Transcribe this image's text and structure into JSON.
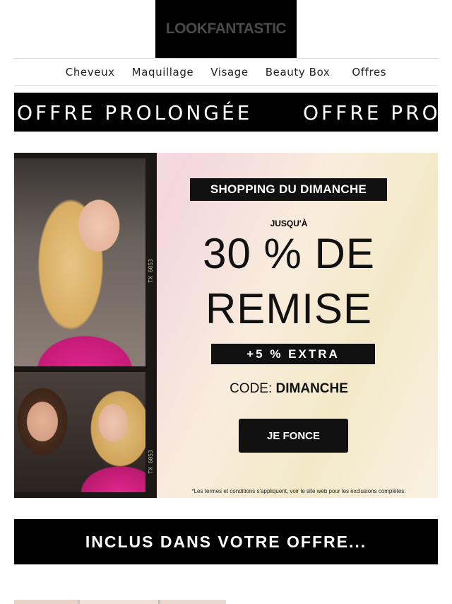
{
  "header": {
    "logo_text": "LOOKFANTASTIC"
  },
  "nav": {
    "items": [
      {
        "label": "Cheveux"
      },
      {
        "label": "Maquillage"
      },
      {
        "label": "Visage"
      },
      {
        "label": "Beauty Box"
      },
      {
        "label": "Offres"
      }
    ]
  },
  "ticker": {
    "text": "OFFRE PROLONGÉE",
    "repeat_text": "OFFRE PRO"
  },
  "hero": {
    "tag": "SHOPPING DU DIMANCHE",
    "upto": "JUSQU'À",
    "headline_line1": "30 % DE",
    "headline_line2": "REMISE",
    "extra": "+5 % EXTRA",
    "code_label": "CODE:",
    "code_value": "DIMANCHE",
    "cta_label": "JE FONCE",
    "terms": "*Les termes et conditions s'appliquent, voir le site web pour les exclusions complètes.",
    "film_mark_top": "TX 6053",
    "film_mark_bottom": "TX 6053"
  },
  "included_banner": {
    "label": "INCLUS DANS VOTRE OFFRE..."
  },
  "colors": {
    "brand_black": "#000000",
    "accent_pink": "#e1268d"
  }
}
